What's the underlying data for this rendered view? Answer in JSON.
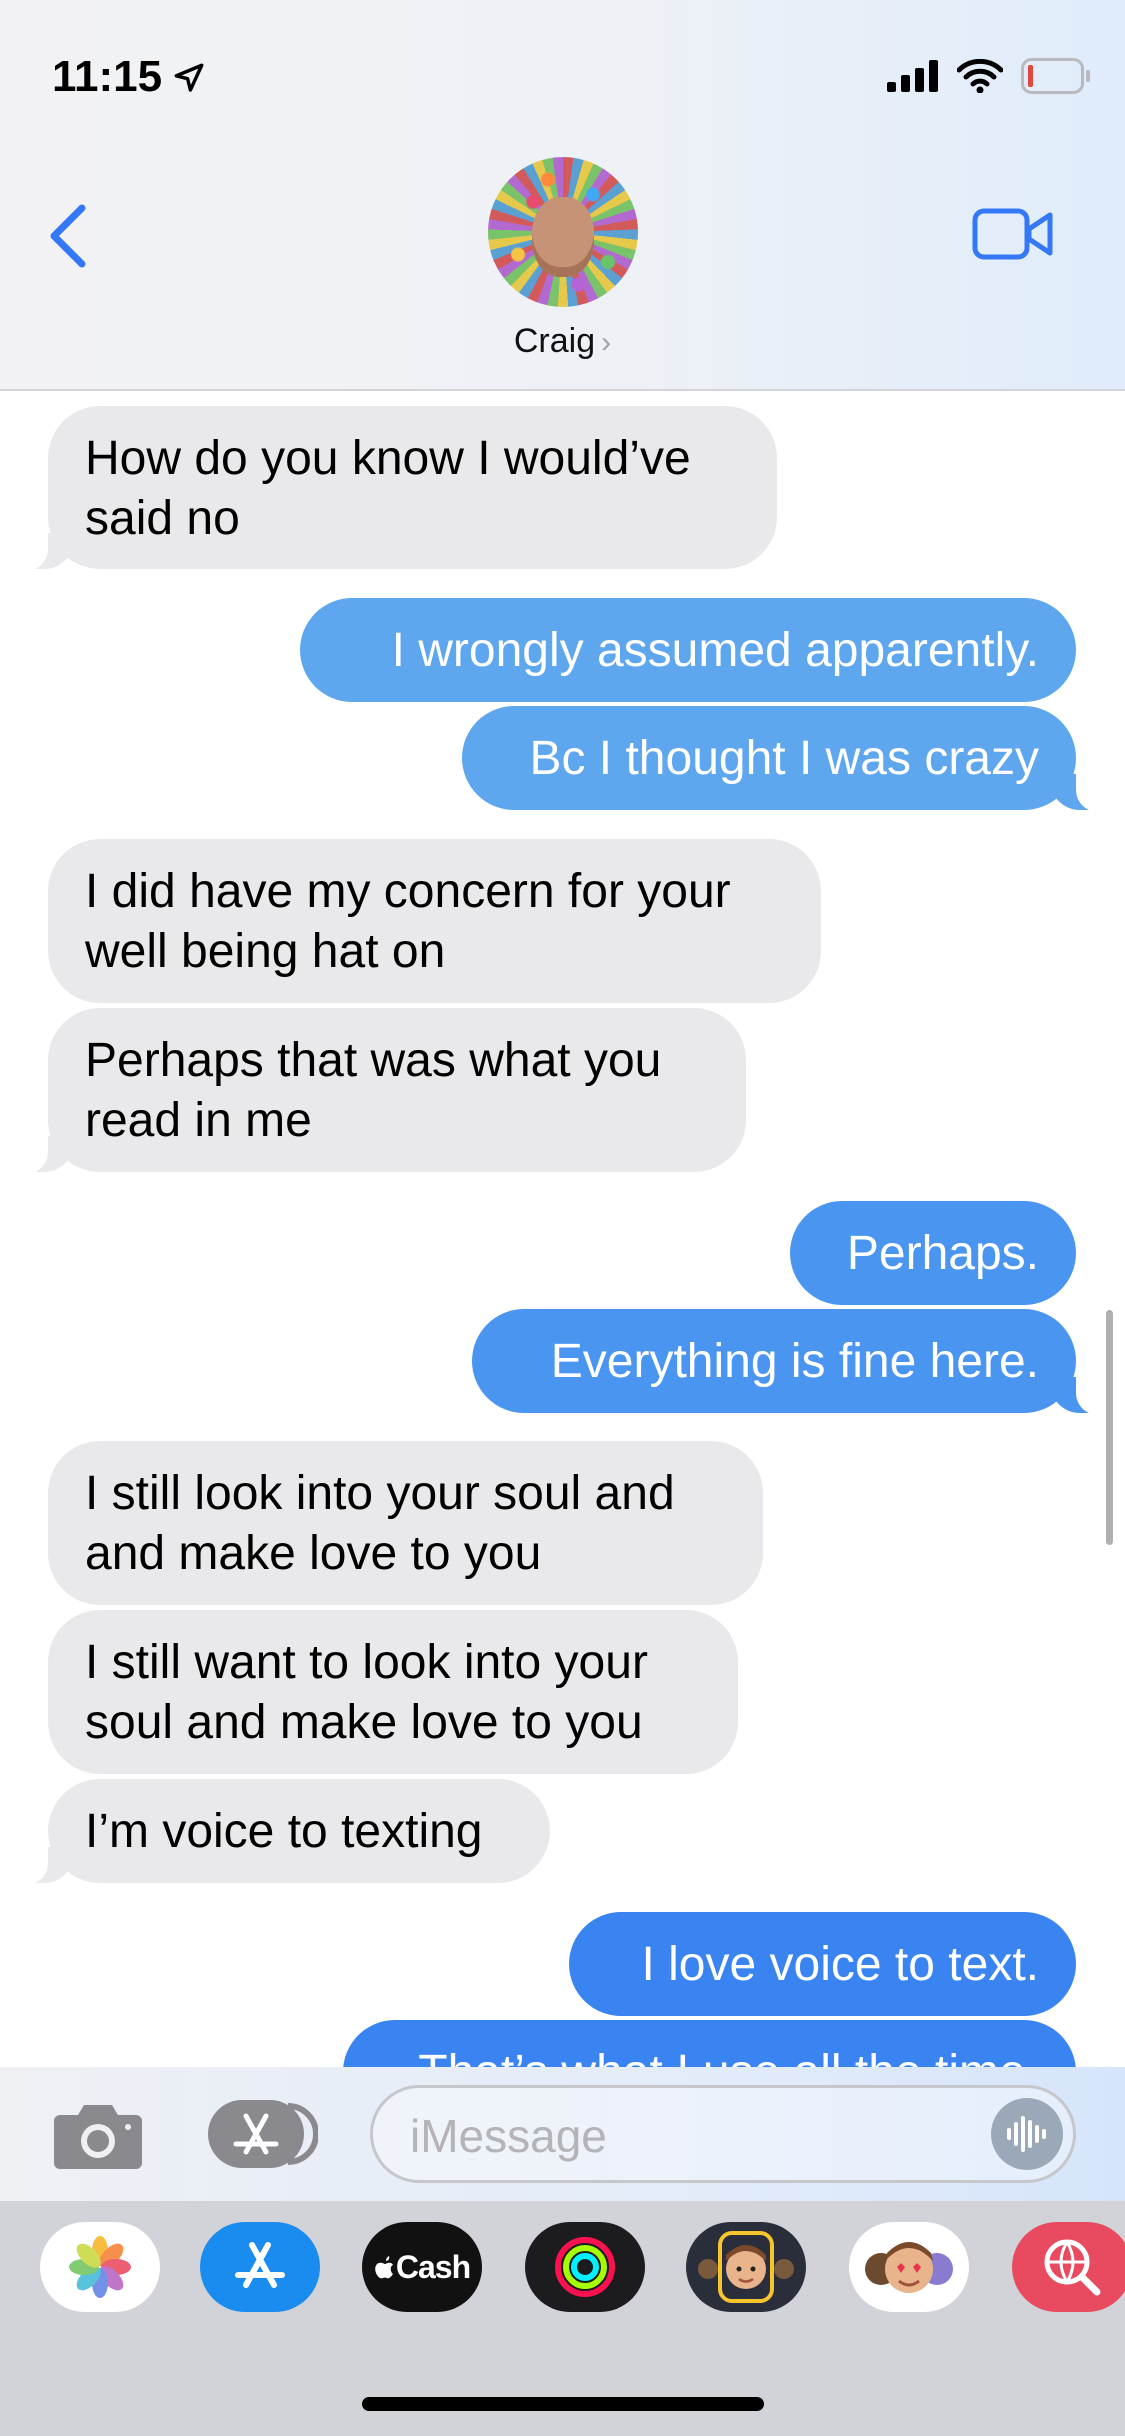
{
  "status_bar": {
    "time": "11:15",
    "icons": [
      "location-arrow-icon",
      "cellular-signal-icon",
      "wifi-icon",
      "battery-low-icon"
    ],
    "battery_color": "#e5463d"
  },
  "header": {
    "contact_name": "Craig",
    "chevron": "›",
    "accent_color": "#3478f6"
  },
  "messages": [
    {
      "direction": "incoming",
      "lines": [
        "How do you know I would’ve",
        "said no"
      ]
    },
    {
      "direction": "outgoing",
      "text": "I wrongly assumed apparently.",
      "color": "#5ea6ee"
    },
    {
      "direction": "outgoing",
      "text": "Bc I thought I was crazy",
      "color": "#5ea6ee"
    },
    {
      "direction": "incoming",
      "lines": [
        "I did have my concern for your",
        "well being hat on"
      ]
    },
    {
      "direction": "incoming",
      "lines": [
        "Perhaps that was what you",
        "read in me"
      ]
    },
    {
      "direction": "outgoing",
      "text": "Perhaps.",
      "color": "#4a95ef"
    },
    {
      "direction": "outgoing",
      "text": "Everything is fine here.",
      "color": "#4a95ef"
    },
    {
      "direction": "incoming",
      "lines": [
        "I still look into your soul and",
        "and make love to you"
      ]
    },
    {
      "direction": "incoming",
      "lines": [
        "I still want to look into your",
        "soul and make love to you"
      ]
    },
    {
      "direction": "incoming",
      "lines": [
        "I’m voice to texting"
      ]
    },
    {
      "direction": "outgoing",
      "text": "I love voice to text.",
      "color": "#3a84f2"
    },
    {
      "direction": "outgoing",
      "text": "That’s what I use all the time.",
      "color": "#3a84f2"
    }
  ],
  "input_bar": {
    "placeholder": "iMessage",
    "left_icons": [
      "camera-icon",
      "app-store-icon"
    ],
    "right_icon": "audio-waveform-icon"
  },
  "app_drawer": {
    "apps": [
      {
        "name": "Photos",
        "icon": "photos-icon"
      },
      {
        "name": "App Store",
        "icon": "app-store-icon"
      },
      {
        "name": "Apple Cash",
        "label": "Cash",
        "icon": "apple-cash-icon"
      },
      {
        "name": "Activity",
        "icon": "activity-rings-icon"
      },
      {
        "name": "Memoji",
        "icon": "memoji-icon"
      },
      {
        "name": "Memoji Stickers",
        "icon": "memoji-stickers-icon"
      },
      {
        "name": "Search Images",
        "icon": "globe-search-icon"
      }
    ]
  }
}
